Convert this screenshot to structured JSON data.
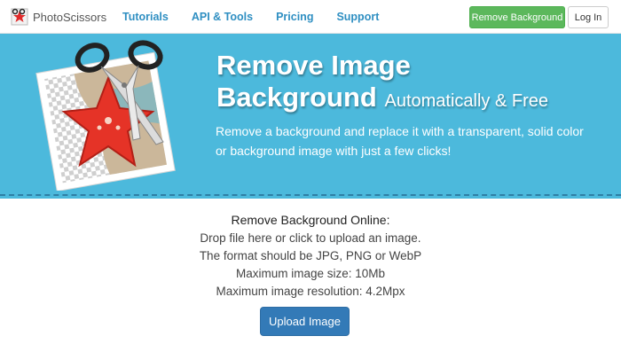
{
  "navbar": {
    "brand_name": "PhotoScissors",
    "links": [
      "Tutorials",
      "API & Tools",
      "Pricing",
      "Support"
    ],
    "remove_background_label": "Remove Background",
    "login_label": "Log In"
  },
  "hero": {
    "title_line1": "Remove Image",
    "title_line2_bold": "Background",
    "title_line2_light": "Automatically & Free",
    "description": "Remove a background and replace it with a transparent, solid color or background image with just a few clicks!"
  },
  "upload": {
    "heading": "Remove Background Online:",
    "lines": [
      "Drop file here or click to upload an image.",
      "The format should be JPG, PNG or WebP",
      "Maximum image size: 10Mb",
      "Maximum image resolution: 4.2Mpx"
    ],
    "button_label": "Upload Image"
  },
  "colors": {
    "hero_bg": "#4cb9dc",
    "link": "#2f8fc2",
    "green_button": "#5cb85c",
    "blue_button": "#337ab7"
  }
}
